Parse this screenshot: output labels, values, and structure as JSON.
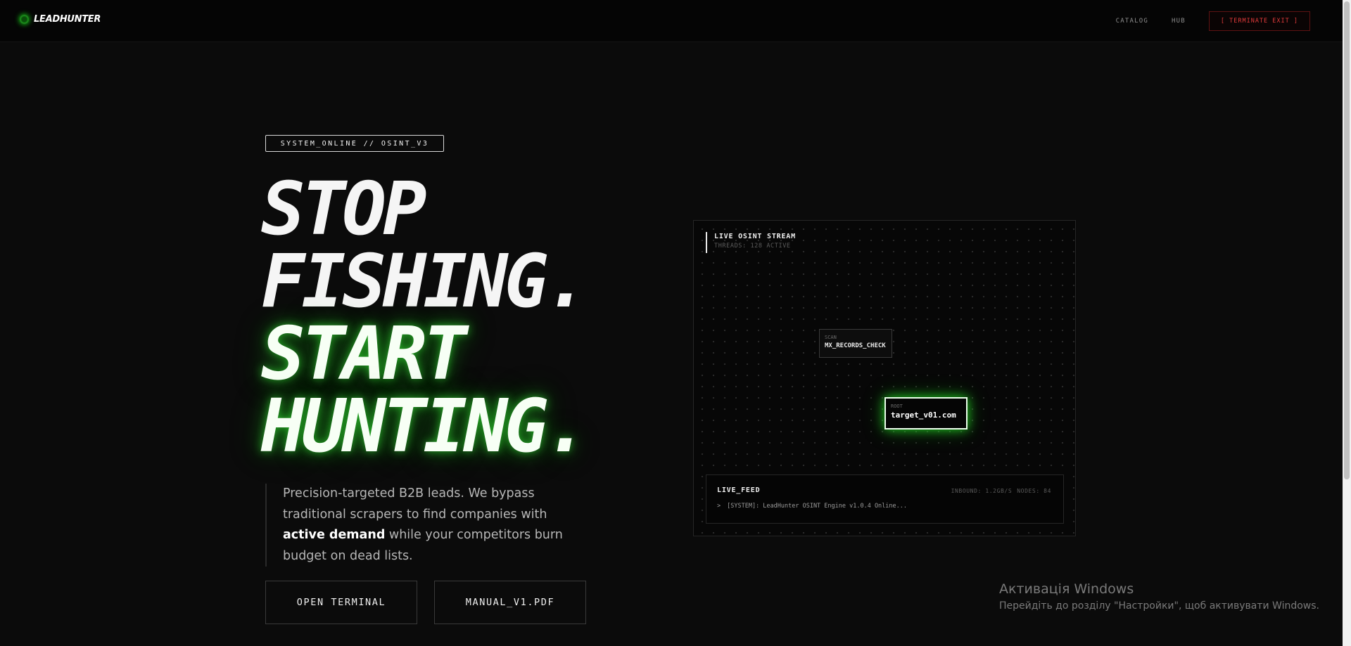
{
  "header": {
    "logo_text": "LEADHUNTER",
    "nav": {
      "catalog": "CATALOG",
      "hub": "HUB",
      "terminate": "[ TERMINATE EXIT ]"
    }
  },
  "hero": {
    "badge": "SYSTEM_ONLINE // OSINT_V3",
    "headline": {
      "line1": "STOP",
      "line2": "FISHING.",
      "line3": "START",
      "line4": "HUNTING."
    },
    "description": {
      "part1": "Precision-targeted B2B leads. We bypass traditional scrapers to find companies with ",
      "emphasis": "active demand",
      "part2": " while your competitors burn budget on dead lists."
    },
    "buttons": {
      "terminal": "OPEN TERMINAL",
      "manual": "MANUAL_V1.PDF"
    }
  },
  "stream": {
    "title": "LIVE OSINT STREAM",
    "subtitle": "THREADS: 128 ACTIVE",
    "scan_node": {
      "label": "SCAN",
      "value": "MX_RECORDS_CHECK"
    },
    "root_node": {
      "label": "ROOT",
      "value": "target_v01.com"
    },
    "feed": {
      "title": "LIVE_FEED",
      "inbound": "INBOUND: 1.2GB/S",
      "nodes": "NODES: 84",
      "prompt": ">",
      "message": "[SYSTEM]: LeadHunter OSINT Engine v1.0.4 Online..."
    }
  },
  "windows_activation": {
    "title": "Активація Windows",
    "subtitle": "Перейдіть до розділу \"Настройки\", щоб активувати Windows."
  },
  "colors": {
    "background": "#0b0b0b",
    "accent_glow": "#30ff30",
    "danger": "#e33b3b"
  }
}
